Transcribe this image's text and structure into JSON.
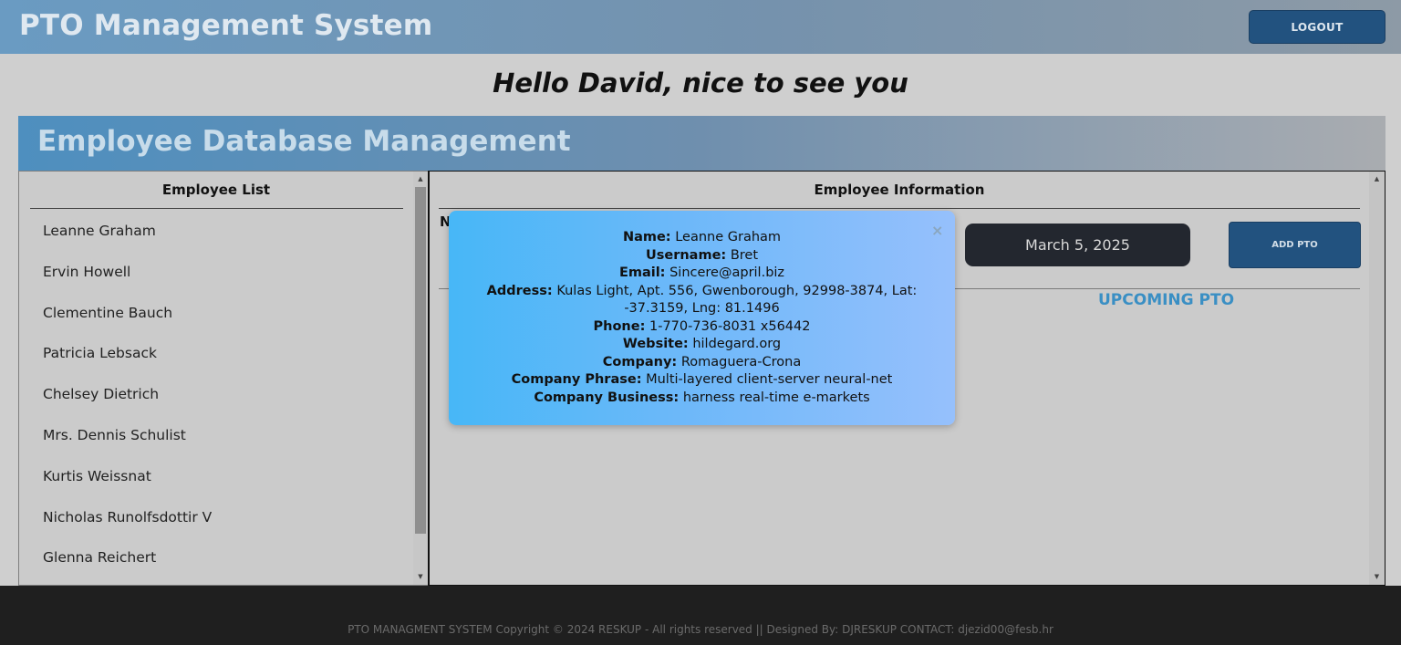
{
  "header": {
    "app_title": "PTO Management System",
    "logout_label": "LOGOUT"
  },
  "greeting": "Hello David, nice to see you",
  "section": {
    "title": "Employee Database Management"
  },
  "employee_list": {
    "heading": "Employee List",
    "items": [
      "Leanne Graham",
      "Ervin Howell",
      "Clementine Bauch",
      "Patricia Lebsack",
      "Chelsey Dietrich",
      "Mrs. Dennis Schulist",
      "Kurtis Weissnat",
      "Nicholas Runolfsdottir V",
      "Glenna Reichert"
    ]
  },
  "employee_info": {
    "heading": "Employee Information",
    "stub_letter": "N",
    "date": "March 5, 2025",
    "add_pto_label": "ADD PTO",
    "upcoming_label": "UPCOMING PTO"
  },
  "modal": {
    "close_glyph": "×",
    "fields": [
      {
        "label": "Name:",
        "value": "Leanne Graham"
      },
      {
        "label": "Username:",
        "value": "Bret"
      },
      {
        "label": "Email:",
        "value": "Sincere@april.biz"
      },
      {
        "label": "Address:",
        "value": "Kulas Light, Apt. 556, Gwenborough, 92998-3874, Lat: -37.3159, Lng: 81.1496"
      },
      {
        "label": "Phone:",
        "value": "1-770-736-8031 x56442"
      },
      {
        "label": "Website:",
        "value": "hildegard.org"
      },
      {
        "label": "Company:",
        "value": "Romaguera-Crona"
      },
      {
        "label": "Company Phrase:",
        "value": "Multi-layered client-server neural-net"
      },
      {
        "label": "Company Business:",
        "value": "harness real-time e-markets"
      }
    ]
  },
  "footer": {
    "text": "PTO MANAGMENT SYSTEM Copyright © 2024 RESKUP - All rights reserved || Designed By: DJRESKUP CONTACT: djezid00@fesb.hr"
  },
  "icons": {
    "scroll_up": "up-arrow-icon",
    "scroll_down": "down-arrow-icon",
    "close": "close-icon"
  }
}
